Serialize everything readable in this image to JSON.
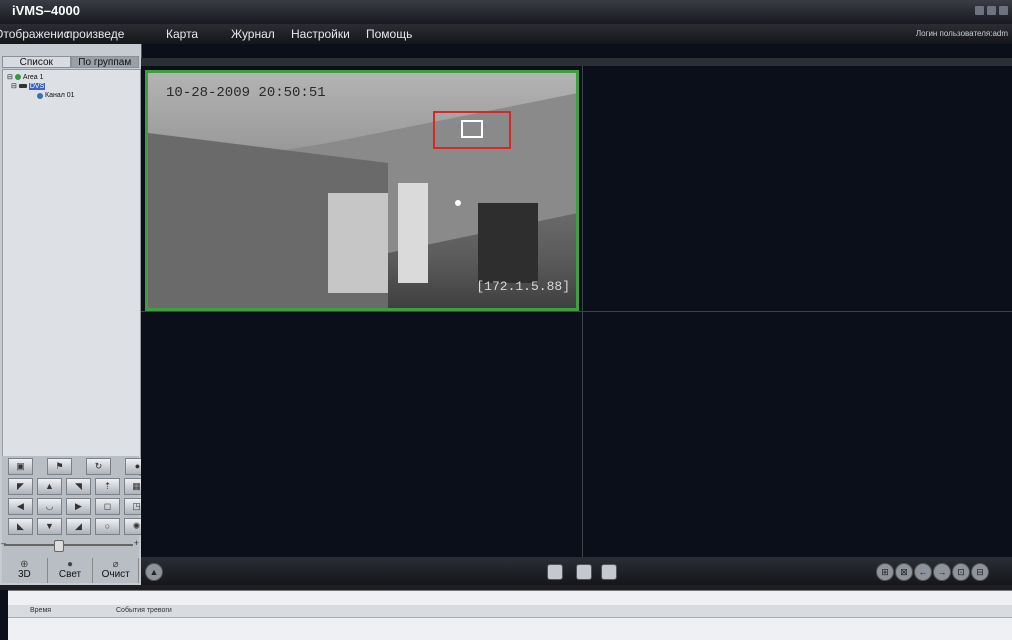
{
  "app": {
    "title": "iVMS–4000"
  },
  "menu": {
    "items": [
      "Отображение",
      "Воспроизведение",
      "Карта",
      "Журнал",
      "Настройки",
      "Помощь"
    ],
    "item1_display": "Отображенис",
    "item2_display": "произведе",
    "login": "Логин пользователя:adm"
  },
  "left": {
    "tabs": [
      "Список",
      "По группам"
    ],
    "tree": {
      "area": "Area 1",
      "device": "DVS",
      "channel": "Канал 01"
    },
    "bottom_buttons": [
      "3D",
      "Свет",
      "Очист"
    ]
  },
  "camera": {
    "timestamp": "10-28-2009 20:50:51",
    "ip": "[172.1.5.88]"
  },
  "alarm": {
    "col_time": "Время",
    "col_events": "События тревоги"
  },
  "colors": {
    "active_border": "#3f9e3f",
    "ptz_target": "#d62828",
    "tree_selected": "#3a64c8"
  }
}
